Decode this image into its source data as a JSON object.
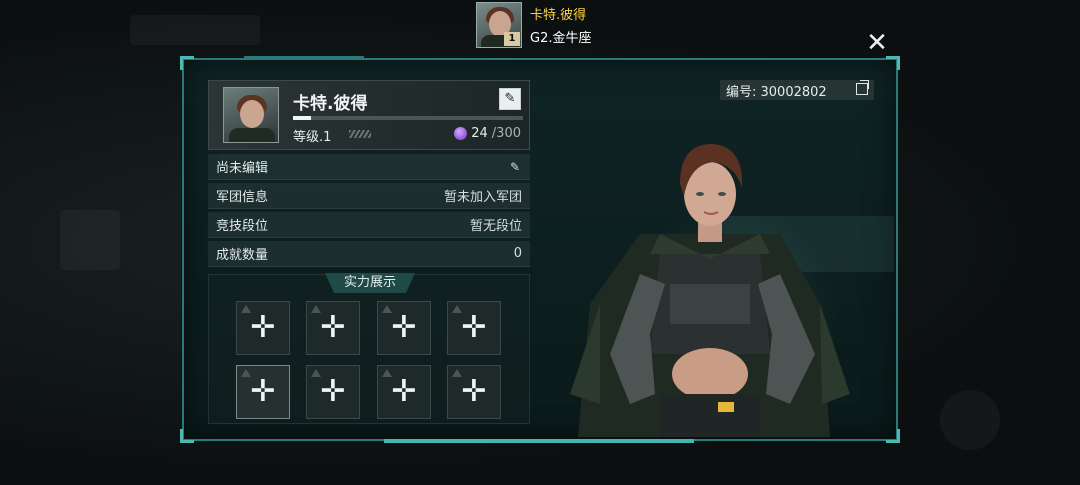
{
  "header": {
    "player_name": "卡特.彼得",
    "avatar_level": "1",
    "rank": "G2.金牛座",
    "close_icon": "close-x-icon"
  },
  "profile": {
    "name": "卡特.彼得",
    "level_label": "等级.1",
    "energy_current": "24",
    "energy_max": "/300",
    "xp_fraction": 0.08,
    "edit_icon": "pencil-icon"
  },
  "player_id": {
    "label": "编号: 30002802",
    "copy_icon": "copy-icon"
  },
  "info_rows": [
    {
      "label": "尚未编辑",
      "value": ""
    },
    {
      "label": "军团信息",
      "value": "暂未加入军团"
    },
    {
      "label": "竞技段位",
      "value": "暂无段位"
    },
    {
      "label": "成就数量",
      "value": "0"
    }
  ],
  "showcase": {
    "title": "实力展示",
    "slot_icon": "plus-icon",
    "slots": 8
  },
  "colors": {
    "accent": "#2c7a78",
    "name_gold": "#ffd24a",
    "energy_purple": "#8a4fd6"
  }
}
